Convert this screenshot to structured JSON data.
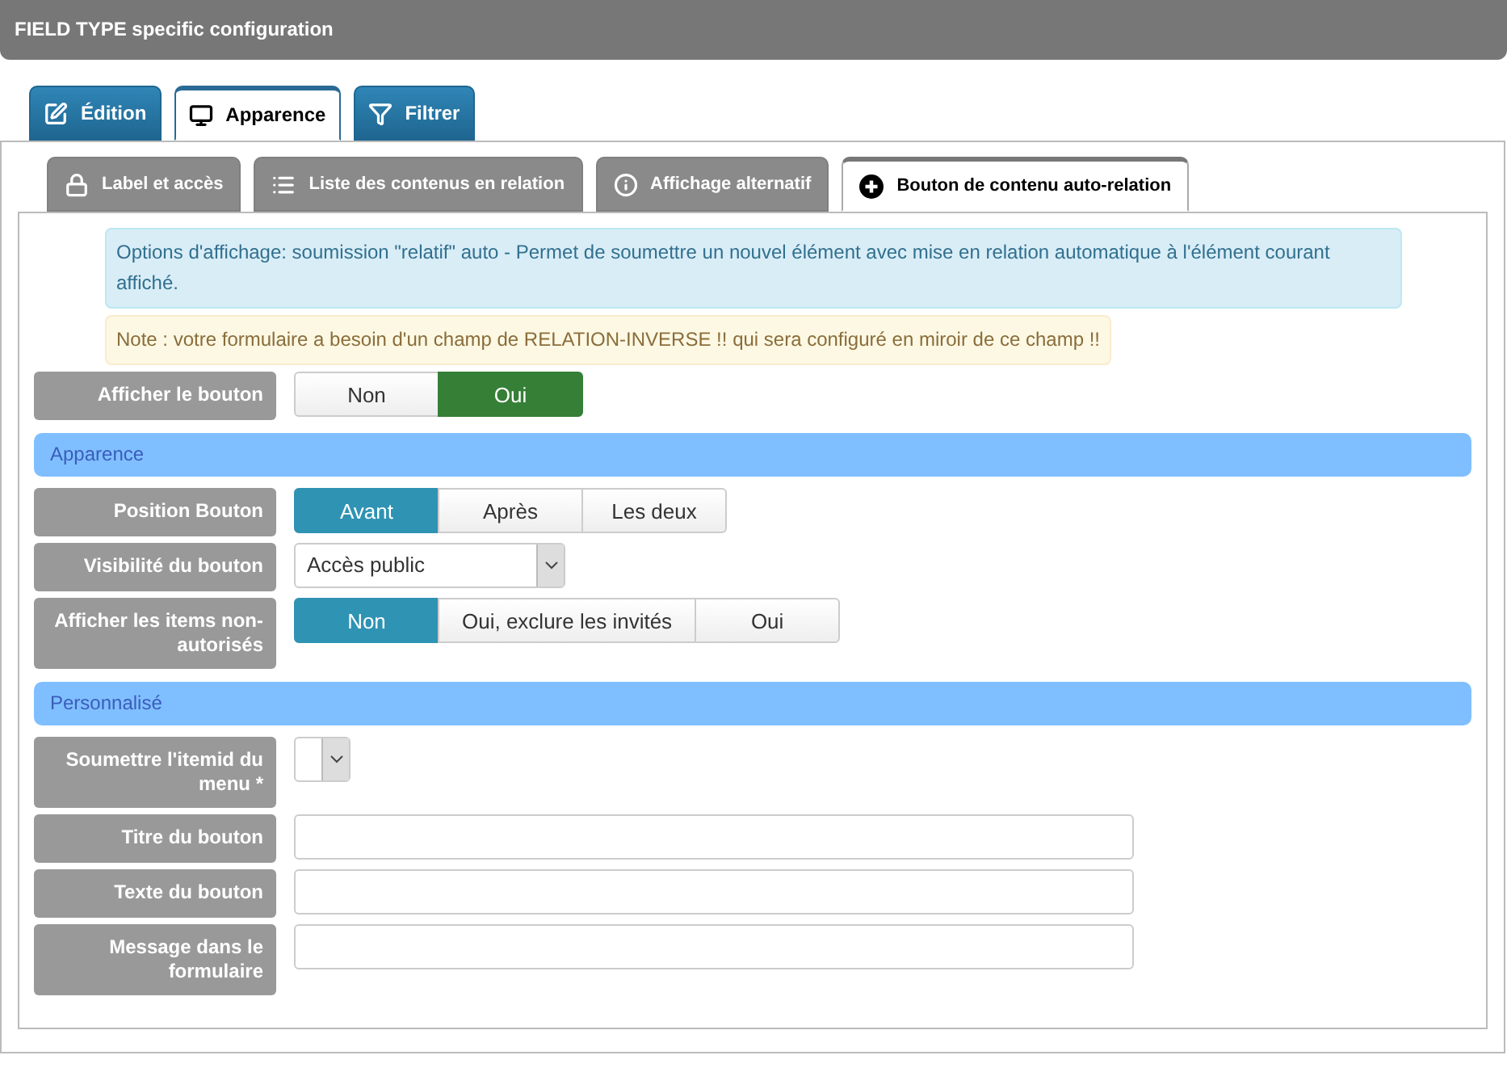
{
  "header": {
    "title": "FIELD TYPE specific configuration"
  },
  "tabs": [
    {
      "label": "Édition",
      "selected": false
    },
    {
      "label": "Apparence",
      "selected": true
    },
    {
      "label": "Filtrer",
      "selected": false
    }
  ],
  "subtabs": [
    {
      "label": "Label et accès",
      "selected": false
    },
    {
      "label": "Liste des contenus en relation",
      "selected": false
    },
    {
      "label": "Affichage alternatif",
      "selected": false
    },
    {
      "label": "Bouton de contenu auto-relation",
      "selected": true
    }
  ],
  "alerts": [
    {
      "kind": "info",
      "text": "Options d'affichage: soumission \"relatif\" auto - Permet de soumettre un nouvel élément avec mise en relation automatique à l'élément courant affiché."
    },
    {
      "kind": "warning",
      "text": "Note : votre formulaire a besoin d'un champ de RELATION-INVERSE !! qui sera configuré en miroir de ce champ !!"
    }
  ],
  "rows": [
    {
      "kind": "toggle",
      "label": "Afficher le bouton",
      "color": "#357f36",
      "options": [
        {
          "label": "Non",
          "selected": false
        },
        {
          "label": "Oui",
          "selected": true
        }
      ]
    },
    {
      "kind": "section",
      "label": "Apparence"
    },
    {
      "kind": "toggle",
      "label": "Position Bouton",
      "color": "#2f93b3",
      "options": [
        {
          "label": "Avant",
          "selected": true
        },
        {
          "label": "Après",
          "selected": false
        },
        {
          "label": "Les deux",
          "selected": false
        }
      ]
    },
    {
      "kind": "select",
      "label": "Visibilité du bouton",
      "value": "Accès public"
    },
    {
      "kind": "toggle",
      "label": "Afficher les items non-autorisés",
      "color": "#2f93b3",
      "options": [
        {
          "label": "Non",
          "selected": true
        },
        {
          "label": "Oui, exclure les invités",
          "selected": false
        },
        {
          "label": "Oui",
          "selected": false
        }
      ]
    },
    {
      "kind": "section",
      "label": "Personnalisé"
    },
    {
      "kind": "select",
      "label": "Soumettre l'itemid du menu *"
    },
    {
      "kind": "text",
      "label": "Titre du bouton"
    },
    {
      "kind": "text",
      "label": "Texte du bouton"
    },
    {
      "kind": "text",
      "label": "Message dans le formulaire"
    }
  ]
}
